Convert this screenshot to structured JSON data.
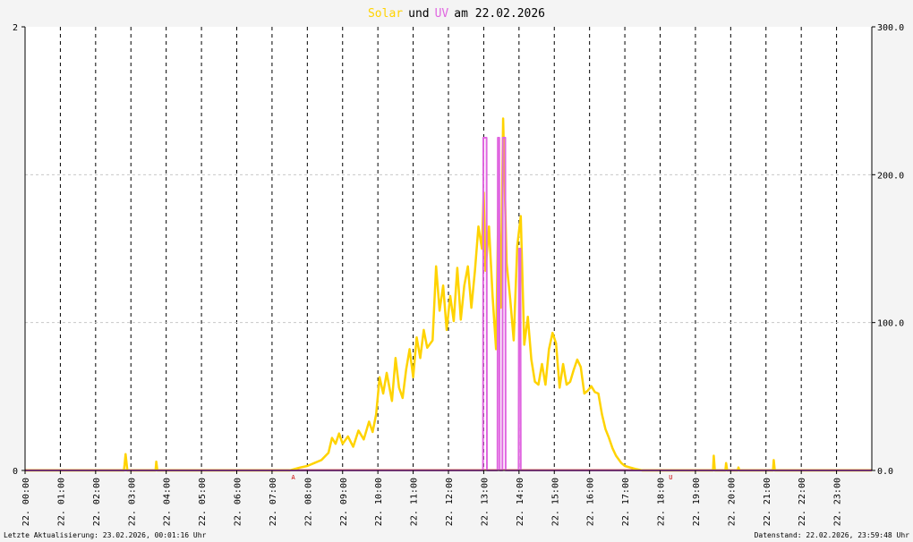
{
  "title": {
    "solar": "Solar",
    "und": "und",
    "uv": "UV",
    "rest": "am 22.02.2026"
  },
  "footer": {
    "left": "Letzte Aktualisierung: 23.02.2026, 00:01:16 Uhr",
    "right": "Datenstand: 22.02.2026, 23:59:48 Uhr"
  },
  "colors": {
    "solar": "#FFD300",
    "uv": "#E066E0",
    "baseline": "#F07060",
    "background": "#F4F4F4"
  },
  "chart_data": {
    "type": "line",
    "x_tick_labels": [
      "22. 00:00",
      "22. 01:00",
      "22. 02:00",
      "22. 03:00",
      "22. 04:00",
      "22. 05:00",
      "22. 06:00",
      "22. 07:00",
      "22. 08:00",
      "22. 09:00",
      "22. 10:00",
      "22. 11:00",
      "22. 12:00",
      "22. 13:00",
      "22. 14:00",
      "22. 15:00",
      "22. 16:00",
      "22. 17:00",
      "22. 18:00",
      "22. 19:00",
      "22. 20:00",
      "22. 21:00",
      "22. 22:00",
      "22. 23:00"
    ],
    "left_axis": {
      "ticks": [
        "2",
        "0"
      ],
      "range": [
        0,
        2
      ]
    },
    "right_axis": {
      "ticks": [
        "300.0",
        "200.0",
        "100.0",
        "0.0"
      ],
      "range": [
        0,
        300
      ]
    },
    "sun_markers": [
      {
        "label": "A",
        "hour": 7.6
      },
      {
        "label": "U",
        "hour": 18.3
      }
    ],
    "series": [
      {
        "name": "Solar",
        "axis": "right",
        "points": [
          [
            0,
            0
          ],
          [
            2.8,
            0
          ],
          [
            2.82,
            4
          ],
          [
            2.85,
            11
          ],
          [
            2.9,
            0
          ],
          [
            3.7,
            0
          ],
          [
            3.72,
            6
          ],
          [
            3.75,
            0
          ],
          [
            7.5,
            0
          ],
          [
            7.8,
            2
          ],
          [
            8.0,
            3
          ],
          [
            8.2,
            5
          ],
          [
            8.4,
            7
          ],
          [
            8.6,
            12
          ],
          [
            8.7,
            22
          ],
          [
            8.8,
            18
          ],
          [
            8.9,
            25
          ],
          [
            9.0,
            18
          ],
          [
            9.15,
            23
          ],
          [
            9.3,
            16
          ],
          [
            9.45,
            27
          ],
          [
            9.6,
            21
          ],
          [
            9.75,
            33
          ],
          [
            9.85,
            26
          ],
          [
            9.95,
            38
          ],
          [
            10.05,
            63
          ],
          [
            10.15,
            52
          ],
          [
            10.25,
            66
          ],
          [
            10.4,
            47
          ],
          [
            10.5,
            76
          ],
          [
            10.6,
            56
          ],
          [
            10.7,
            49
          ],
          [
            10.8,
            68
          ],
          [
            10.9,
            82
          ],
          [
            11.0,
            63
          ],
          [
            11.1,
            90
          ],
          [
            11.2,
            76
          ],
          [
            11.3,
            95
          ],
          [
            11.4,
            83
          ],
          [
            11.55,
            88
          ],
          [
            11.65,
            138
          ],
          [
            11.75,
            108
          ],
          [
            11.85,
            125
          ],
          [
            11.95,
            95
          ],
          [
            12.05,
            118
          ],
          [
            12.15,
            101
          ],
          [
            12.25,
            137
          ],
          [
            12.35,
            102
          ],
          [
            12.45,
            125
          ],
          [
            12.55,
            138
          ],
          [
            12.65,
            110
          ],
          [
            12.75,
            135
          ],
          [
            12.85,
            165
          ],
          [
            12.95,
            150
          ],
          [
            13.0,
            188
          ],
          [
            13.05,
            135
          ],
          [
            13.15,
            165
          ],
          [
            13.25,
            118
          ],
          [
            13.35,
            82
          ],
          [
            13.42,
            188
          ],
          [
            13.48,
            110
          ],
          [
            13.55,
            238
          ],
          [
            13.6,
            187
          ],
          [
            13.65,
            140
          ],
          [
            13.75,
            116
          ],
          [
            13.85,
            88
          ],
          [
            13.95,
            152
          ],
          [
            14.05,
            172
          ],
          [
            14.15,
            85
          ],
          [
            14.25,
            104
          ],
          [
            14.35,
            75
          ],
          [
            14.45,
            60
          ],
          [
            14.55,
            58
          ],
          [
            14.65,
            72
          ],
          [
            14.75,
            58
          ],
          [
            14.85,
            82
          ],
          [
            14.95,
            93
          ],
          [
            15.05,
            86
          ],
          [
            15.15,
            56
          ],
          [
            15.25,
            72
          ],
          [
            15.35,
            58
          ],
          [
            15.45,
            60
          ],
          [
            15.55,
            68
          ],
          [
            15.65,
            75
          ],
          [
            15.75,
            70
          ],
          [
            15.85,
            52
          ],
          [
            15.95,
            54
          ],
          [
            16.05,
            57
          ],
          [
            16.15,
            53
          ],
          [
            16.25,
            52
          ],
          [
            16.35,
            38
          ],
          [
            16.45,
            28
          ],
          [
            16.55,
            22
          ],
          [
            16.65,
            15
          ],
          [
            16.75,
            10
          ],
          [
            16.9,
            5
          ],
          [
            17.0,
            3
          ],
          [
            17.15,
            2
          ],
          [
            17.3,
            1
          ],
          [
            17.5,
            0
          ],
          [
            19.5,
            0
          ],
          [
            19.52,
            10
          ],
          [
            19.55,
            0
          ],
          [
            19.85,
            0
          ],
          [
            19.87,
            5
          ],
          [
            19.9,
            0
          ],
          [
            20.2,
            0
          ],
          [
            20.22,
            2
          ],
          [
            20.25,
            0
          ],
          [
            21.2,
            0
          ],
          [
            21.22,
            7
          ],
          [
            21.25,
            0
          ],
          [
            24,
            0
          ]
        ]
      },
      {
        "name": "UV",
        "axis": "left",
        "points": [
          [
            0,
            0
          ],
          [
            12.98,
            0
          ],
          [
            12.99,
            1.5
          ],
          [
            13.08,
            1.5
          ],
          [
            13.09,
            0
          ],
          [
            13.39,
            0
          ],
          [
            13.4,
            1.5
          ],
          [
            13.44,
            1.5
          ],
          [
            13.45,
            0
          ],
          [
            13.53,
            0
          ],
          [
            13.54,
            1.5
          ],
          [
            13.61,
            1.5
          ],
          [
            13.62,
            0
          ],
          [
            13.99,
            0
          ],
          [
            14.0,
            1.0
          ],
          [
            14.04,
            1.0
          ],
          [
            14.05,
            0
          ],
          [
            24,
            0
          ]
        ]
      }
    ],
    "grid": true
  }
}
